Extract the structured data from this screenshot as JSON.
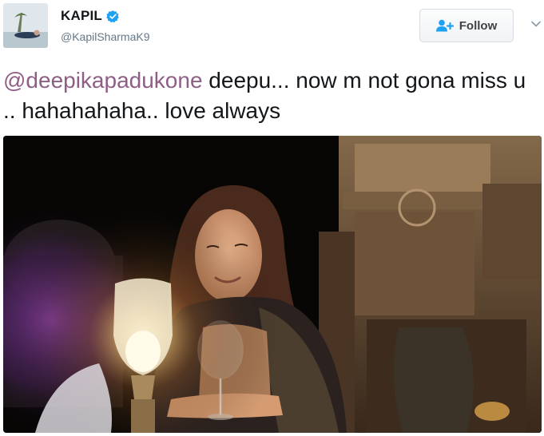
{
  "user": {
    "display_name": "KAPIL",
    "handle": "@KapilSharmaK9",
    "verified_icon": "verified-badge-icon",
    "avatar_icon": "profile-photo"
  },
  "actions": {
    "follow_label": "Follow",
    "follow_icon": "add-person-icon",
    "menu_icon": "chevron-down-icon"
  },
  "tweet": {
    "mention": "@deepikapadukone",
    "body": " deepu... now m not gona miss u .. hahahahaha.. love always"
  },
  "colors": {
    "mention": "#8f5e86",
    "verified": "#1da1f2",
    "follow_icon": "#1da1f2",
    "text": "#14171a",
    "handle": "#657786"
  }
}
